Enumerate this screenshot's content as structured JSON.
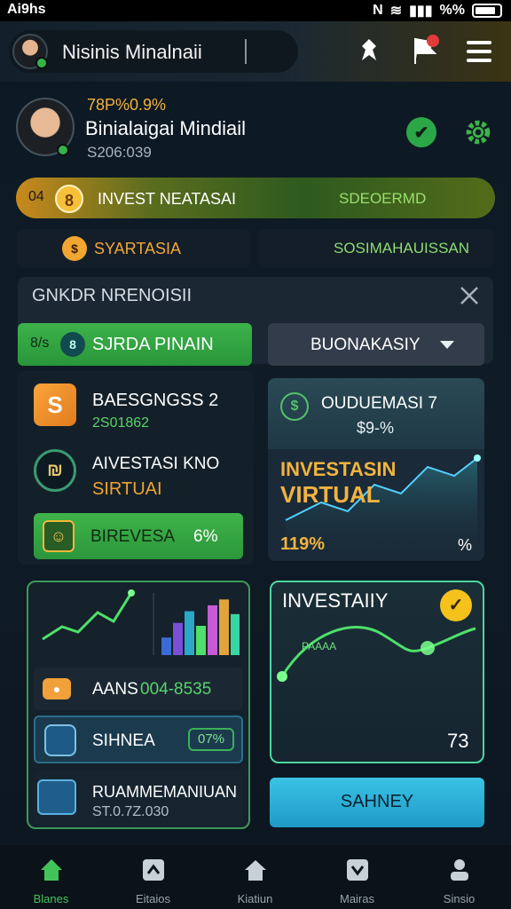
{
  "status_bar": {
    "left": "Ai9hs",
    "right": "N",
    "battery_pct": "%%"
  },
  "header": {
    "title": "Nisinis Minalnaii",
    "notification_count": ""
  },
  "profile": {
    "percent": "78P%0.9%",
    "name": "Binialaigai Mindiail",
    "value": "S206:039"
  },
  "banner": {
    "left": "04",
    "coin": "8",
    "middle": "INVEST NEATASAI",
    "right": "SDEOERMD"
  },
  "pills": {
    "left_icon": "$",
    "left": "SYARTASIA",
    "right": "SOSIMAHAUISSAN"
  },
  "panel": {
    "title": "GNKDR NRENOISII",
    "green_prefix": "8/s",
    "green_icon": "8",
    "green_label": "SJRDA PINAIN",
    "dropdown_label": "BUONAKASIY"
  },
  "left_cards": {
    "card1": {
      "title": "BAESGNGSS  2",
      "sub": "2S01862"
    },
    "card2": {
      "title": "AIVESTASI KNO",
      "sub": "SIRTUAI"
    },
    "card3": {
      "title": "BIREVESA",
      "value": "6%"
    }
  },
  "right_card": {
    "title": "OUDUEMASI 7",
    "sub": "$9-%",
    "headline1": "INVESTASIN",
    "headline2": "VIRTUAL",
    "pct_left": "119%",
    "pct_right": "%"
  },
  "bottom_left": {
    "row1": {
      "label": "AANS",
      "value": "004-8535"
    },
    "row2": {
      "label": "SIHNEA",
      "badge": "07%"
    },
    "row3": {
      "title": "RUAMMEMANIUAN",
      "sub": "ST.0.7Z.030"
    },
    "bars": [
      30,
      55,
      75,
      50,
      85,
      95,
      70
    ]
  },
  "bottom_right": {
    "title": "INVESTAIIY",
    "value": "73",
    "curve_label": "PAAAA"
  },
  "cta": {
    "label": "SAHNEY"
  },
  "nav": [
    {
      "label": "Blanes",
      "icon": "home-icon",
      "active": true
    },
    {
      "label": "Eitaios",
      "icon": "chart-icon",
      "active": false
    },
    {
      "label": "Kiatiun",
      "icon": "house-icon",
      "active": false
    },
    {
      "label": "Mairas",
      "icon": "play-icon",
      "active": false
    },
    {
      "label": "Sinsio",
      "icon": "person-icon",
      "active": false
    }
  ],
  "colors": {
    "accent_green": "#3db24a",
    "accent_orange": "#f2b33f",
    "cta_blue": "#2aaed6"
  }
}
